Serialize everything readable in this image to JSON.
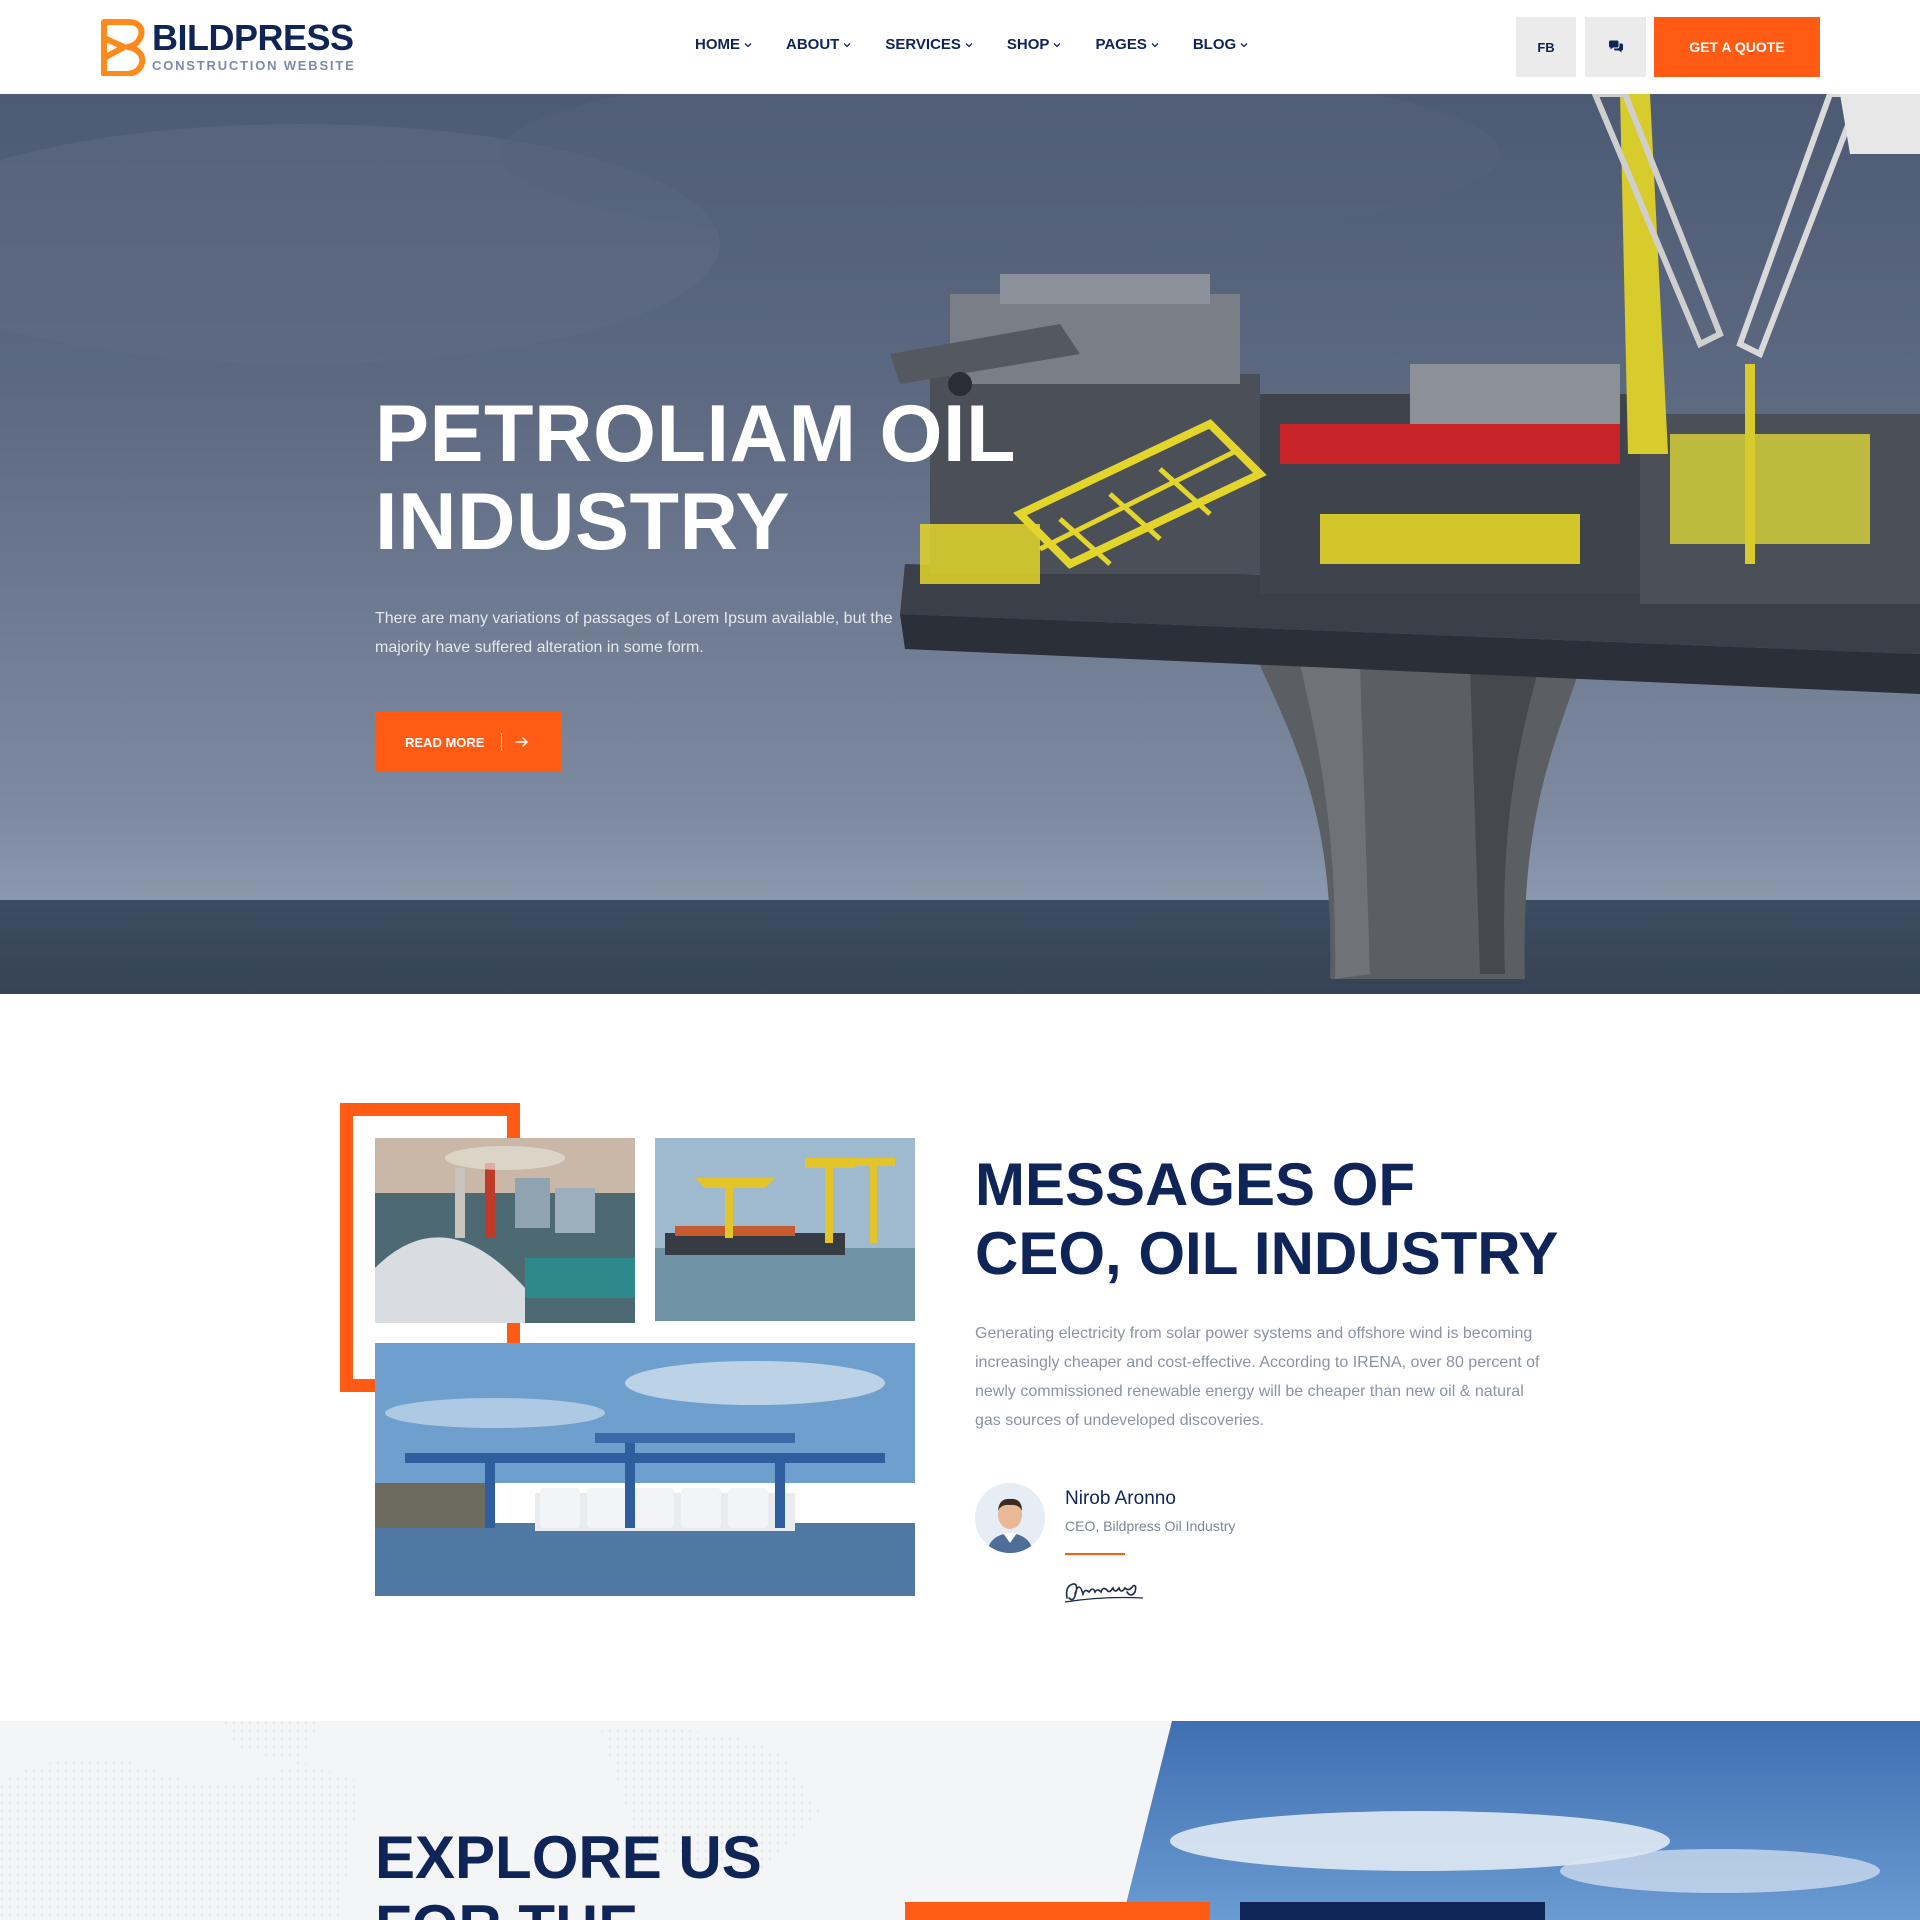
{
  "colors": {
    "accent": "#ff5b14",
    "navy": "#0f2557",
    "muted": "#8a93a6"
  },
  "header": {
    "logo": {
      "name": "BILDPRESS",
      "tagline": "CONSTRUCTION WEBSITE"
    },
    "nav": [
      {
        "label": "HOME"
      },
      {
        "label": "ABOUT"
      },
      {
        "label": "SERVICES"
      },
      {
        "label": "SHOP"
      },
      {
        "label": "PAGES"
      },
      {
        "label": "BLOG"
      }
    ],
    "fb_label": "FB",
    "chat_icon": "chat-icon",
    "quote_label": "GET A QUOTE"
  },
  "hero": {
    "title_line1": "PETROLIAM OIL",
    "title_line2": "INDUSTRY",
    "text": "There are many variations of passages of Lorem Ipsum available, but the majority have suffered alteration in some form.",
    "button_label": "READ MORE",
    "button_icon": "arrow-right-icon"
  },
  "ceo": {
    "title_line1": "MESSAGES OF",
    "title_line2": "CEO, OIL INDUSTRY",
    "text": "Generating electricity from solar power systems and offshore wind is becoming increasingly cheaper and cost-effective. According to IRENA, over 80 percent of newly commissioned renewable energy will be cheaper than new oil & natural gas sources of undeveloped discoveries.",
    "name": "Nirob Aronno",
    "role": "CEO, Bildpress Oil Industry"
  },
  "explore": {
    "title_line1": "EXPLORE US",
    "title_line2": "FOR THE"
  }
}
